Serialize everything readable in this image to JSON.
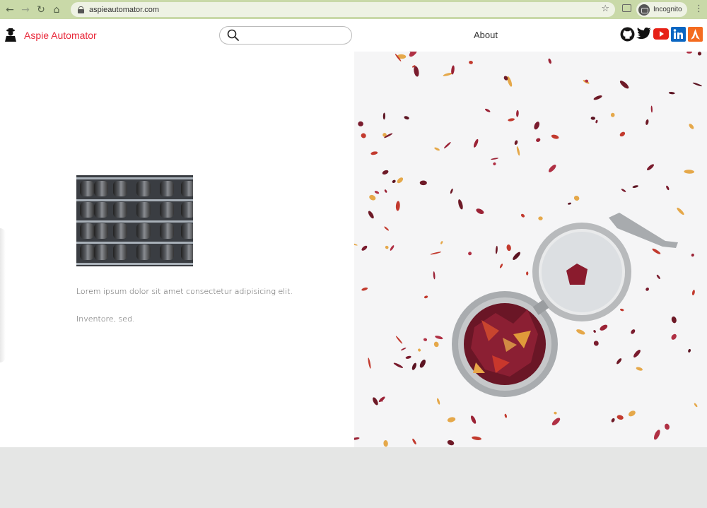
{
  "browser": {
    "url": "aspieautomator.com",
    "profile_label": "Incognito"
  },
  "header": {
    "brand": "Aspie Automator",
    "search_placeholder": "",
    "nav_about": "About",
    "socials": [
      "github-icon",
      "twitter-icon",
      "youtube-icon",
      "linkedin-icon",
      "launch-icon"
    ]
  },
  "main": {
    "paragraph1": "Lorem ipsum dolor sit amet consectetur adipisicing elit.",
    "paragraph2": "Inventore, sed."
  },
  "colors": {
    "chrome": "#c9d9a8",
    "brand": "#e8283a",
    "footer": "#e5e6e5"
  }
}
